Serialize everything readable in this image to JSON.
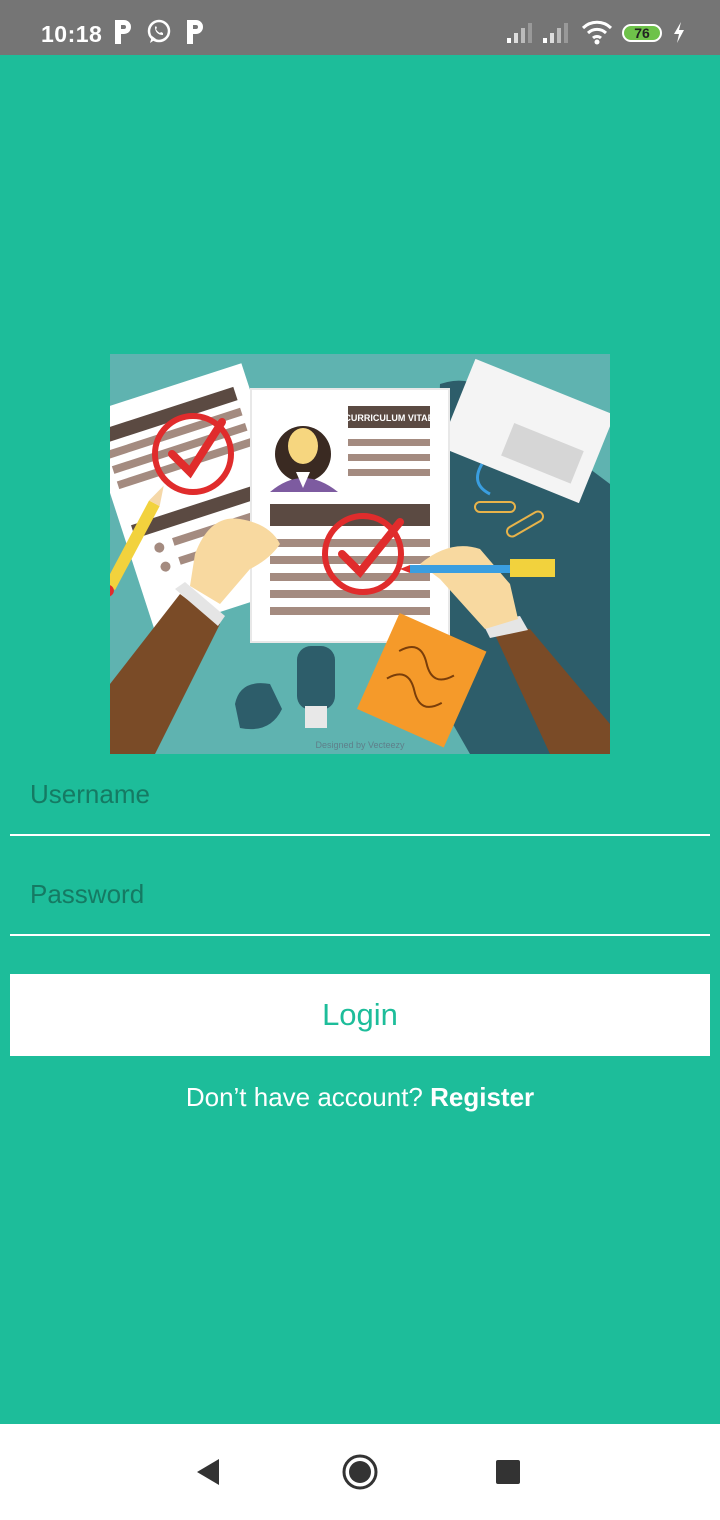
{
  "status_bar": {
    "time": "10:18",
    "notification_icons": [
      "p-app-icon",
      "whatsapp-icon",
      "p-app-icon"
    ],
    "battery_level": "76",
    "battery_color": "#6ec24a"
  },
  "illustration": {
    "header_text": "CURRICULUM VITAE",
    "watermark": "Designed by Vecteezy"
  },
  "form": {
    "username_placeholder": "Username",
    "password_placeholder": "Password",
    "login_label": "Login"
  },
  "register": {
    "prompt": "Don’t have account?",
    "link_label": "Register"
  },
  "colors": {
    "background": "#1dbd9a",
    "status_bar": "#757575",
    "button_bg": "#ffffff",
    "button_text": "#1dbd9a"
  }
}
